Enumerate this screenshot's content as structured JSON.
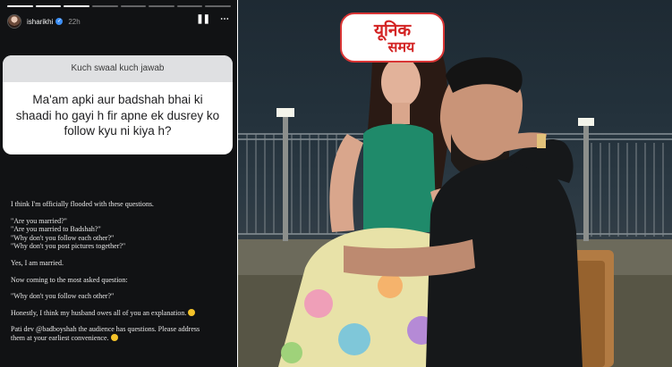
{
  "story": {
    "username": "isharikhi",
    "time": "22h",
    "progress": {
      "segments": 8,
      "seen": 3
    },
    "question": {
      "title": "Kuch swaal kuch jawab",
      "text": "Ma'am apki aur badshah bhai ki shaadi ho gayi h fir apne ek dusrey ko follow kyu ni kiya h?"
    },
    "caption": {
      "l1": "I think I'm officially flooded with these questions.",
      "l2": "\"Are you married?\"",
      "l3": "\"Are you married to Badshah?\"",
      "l4": "\"Why don't you follow each other?\"",
      "l5": "\"Why don't you post pictures together?\"",
      "l6": "Yes, I am married.",
      "l7": "Now coming to the most asked question:",
      "l8": "\"Why don't you follow each other?\"",
      "l9": "Honestly, I think my husband owes all of you an explanation.",
      "l10_prefix": "Pati dev ",
      "l10_mention": "@badboyshah",
      "l10_suffix": " the audience has questions. Please address",
      "l11": "them at your earliest convenience."
    },
    "icons": {
      "avatar": "avatar",
      "verified": "verified-badge-icon",
      "pause": "pause-icon",
      "more": "more-options-icon",
      "emoji": "smiling-emoji-icon"
    }
  },
  "watermark": {
    "line1": "यूनिक",
    "line2": "समय"
  },
  "colors": {
    "story_bg": "#111214",
    "question_header": "#dfe0e2",
    "logo_red": "#d32323",
    "verified_blue": "#3d8ff6"
  }
}
